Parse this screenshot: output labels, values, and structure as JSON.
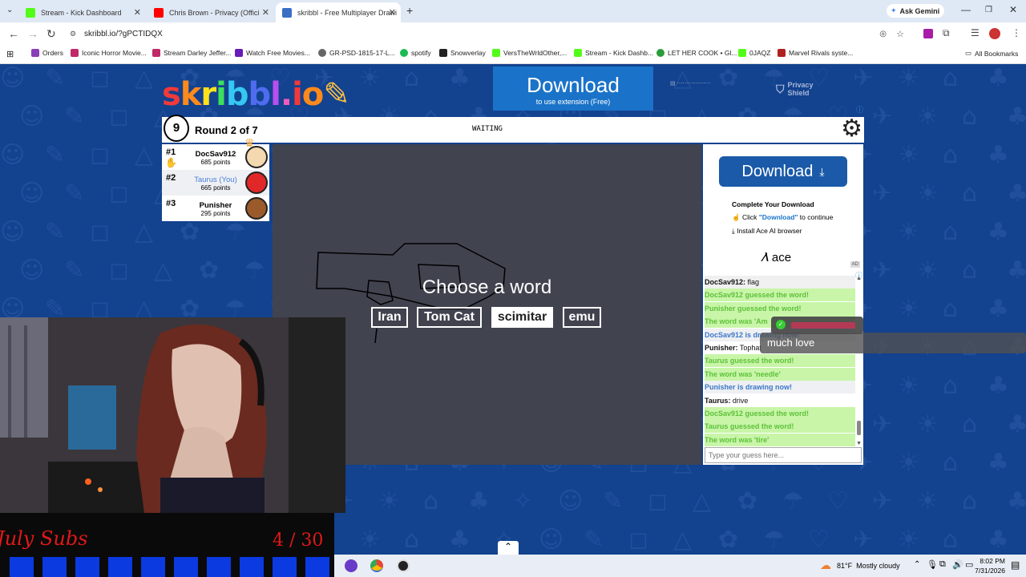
{
  "browser": {
    "tabs": [
      {
        "label": "Stream - Kick Dashboard",
        "color": "#53fc18"
      },
      {
        "label": "Chris Brown - Privacy (Offici",
        "color": "#ff0000"
      },
      {
        "label": "skribbl - Free Multiplayer Drawi",
        "color": "#3a6fc4"
      }
    ],
    "ask_gemini": "Ask Gemini",
    "url": "skribbl.io/?gPCTIDQX",
    "bookmarks": [
      "Orders",
      "Iconic Horror Movie...",
      "Stream Darley Jeffer...",
      "Watch Free Movies...",
      "GR-PSD-1815-17-L...",
      "spotify",
      "Snowverlay",
      "VersTheWrldOther,...",
      "Stream - Kick Dashb...",
      "LET HER COOK • Gl...",
      "0JAQZ",
      "Marvel Rivals syste..."
    ],
    "all_bookmarks": "All Bookmarks"
  },
  "ad": {
    "download_title": "Download",
    "download_sub": "to use extension (Free)",
    "privacy": "Privacy Shield"
  },
  "game": {
    "logo": "skribbl.io",
    "timer": "9",
    "round": "Round 2 of 7",
    "status": "WAITING",
    "players": [
      {
        "rank": "#1",
        "name": "DocSav912",
        "points": "685 points",
        "you": false,
        "color": "#f3d8b0"
      },
      {
        "rank": "#2",
        "name": "Taurus (You)",
        "points": "665 points",
        "you": true,
        "color": "#e02828"
      },
      {
        "rank": "#3",
        "name": "Punisher",
        "points": "295 points",
        "you": false,
        "color": "#9a5a2a"
      }
    ],
    "choose": "Choose a word",
    "words": [
      "Iran",
      "Tom Cat",
      "scimitar",
      "emu"
    ]
  },
  "sidead": {
    "button": "Download",
    "complete": "Complete Your Download",
    "click_prefix": "Click ",
    "click_link": "\"Download\"",
    "click_suffix": " to continue",
    "install": "Install Ace AI browser",
    "brand": "ace",
    "ad_badge": "AD"
  },
  "chat": {
    "lines": [
      {
        "type": "w",
        "user": "DocSav912:",
        "text": " flag"
      },
      {
        "type": "g",
        "user": "",
        "text": "DocSav912 guessed the word!"
      },
      {
        "type": "g",
        "user": "",
        "text": "Punisher guessed the word!"
      },
      {
        "type": "g",
        "user": "",
        "text": "The word was 'Am"
      },
      {
        "type": "b",
        "user": "",
        "text": "DocSav912 is drawing now!"
      },
      {
        "type": "w",
        "user": "Punisher:",
        "text": " Tophat"
      },
      {
        "type": "g",
        "user": "",
        "text": "Taurus guessed the word!"
      },
      {
        "type": "g",
        "user": "",
        "text": "The word was 'needle'"
      },
      {
        "type": "b",
        "user": "",
        "text": "Punisher is drawing now!"
      },
      {
        "type": "w",
        "user": "Taurus:",
        "text": " drive"
      },
      {
        "type": "g",
        "user": "",
        "text": "DocSav912 guessed the word!"
      },
      {
        "type": "g",
        "user": "",
        "text": "Taurus guessed the word!"
      },
      {
        "type": "g",
        "user": "",
        "text": "The word was 'tire'"
      }
    ],
    "placeholder": "Type your guess here...",
    "overlay_msg": "much love"
  },
  "stream": {
    "subs_label": "July Subs",
    "subs_count": "4 / 30"
  },
  "taskbar": {
    "weather": "81°F  Mostly cloudy",
    "time": "8:02 PM",
    "date": "7/31/2026"
  }
}
